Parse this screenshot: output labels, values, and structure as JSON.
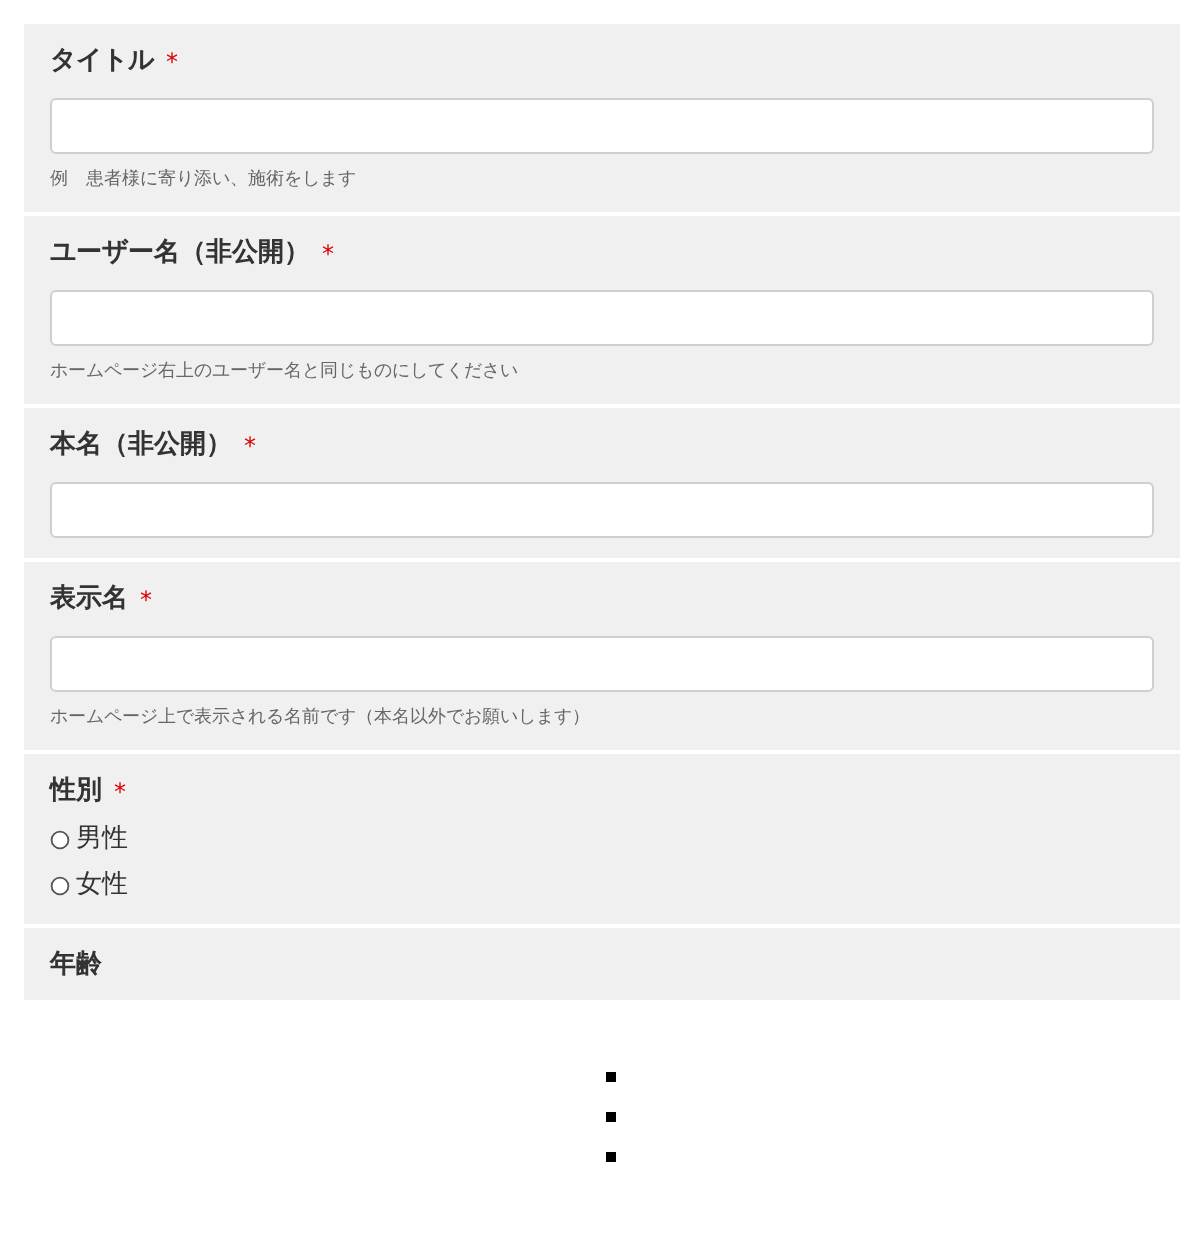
{
  "form": {
    "fields": [
      {
        "kind": "text",
        "label": "タイトル",
        "required_mark": "*",
        "help": "例　患者様に寄り添い、施術をします"
      },
      {
        "kind": "text",
        "label": "ユーザー名（非公開）",
        "required_mark": "*",
        "help": "ホームページ右上のユーザー名と同じものにしてください"
      },
      {
        "kind": "text",
        "label": "本名（非公開）",
        "required_mark": "*"
      },
      {
        "kind": "text",
        "label": "表示名",
        "required_mark": "*",
        "help": "ホームページ上で表示される名前です（本名以外でお願いします）"
      },
      {
        "kind": "radio",
        "label": "性別",
        "required_mark": "*",
        "options": [
          {
            "label": "男性",
            "selected": false
          },
          {
            "label": "女性",
            "selected": false
          }
        ]
      },
      {
        "kind": "cut",
        "label": "年齢"
      }
    ]
  }
}
